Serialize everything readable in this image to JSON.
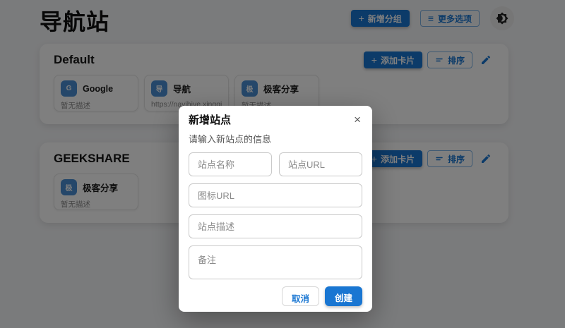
{
  "page": {
    "title": "导航站"
  },
  "icons": {
    "plus": "+",
    "menu": "≡",
    "close": "×"
  },
  "header": {
    "add_group_label": "新增分组",
    "more_options_label": "更多选项"
  },
  "groups": [
    {
      "name": "Default",
      "add_card_label": "添加卡片",
      "sort_label": "排序",
      "cards": [
        {
          "title": "Google",
          "description": "暂无描述",
          "icon_text": "G"
        },
        {
          "title": "导航",
          "description": "https://navihive.xingqiong.i",
          "icon_text": "导"
        },
        {
          "title": "极客分享",
          "description": "暂无描述",
          "icon_text": "极"
        }
      ]
    },
    {
      "name": "GEEKSHARE",
      "add_card_label": "添加卡片",
      "sort_label": "排序",
      "cards": [
        {
          "title": "极客分享",
          "description": "暂无描述",
          "icon_text": "极"
        }
      ]
    }
  ],
  "modal": {
    "title": "新增站点",
    "subtitle": "请输入新站点的信息",
    "fields": {
      "site_name_placeholder": "站点名称",
      "site_url_placeholder": "站点URL",
      "icon_url_placeholder": "图标URL",
      "site_description_placeholder": "站点描述",
      "remark_placeholder": "备注"
    },
    "cancel_label": "取消",
    "create_label": "创建"
  },
  "colors": {
    "primary": "#1976d2",
    "card_icon": "#4a8fd4",
    "overlay": "rgba(0,0,0,0.5)",
    "modal_bg": "#ffffff"
  }
}
